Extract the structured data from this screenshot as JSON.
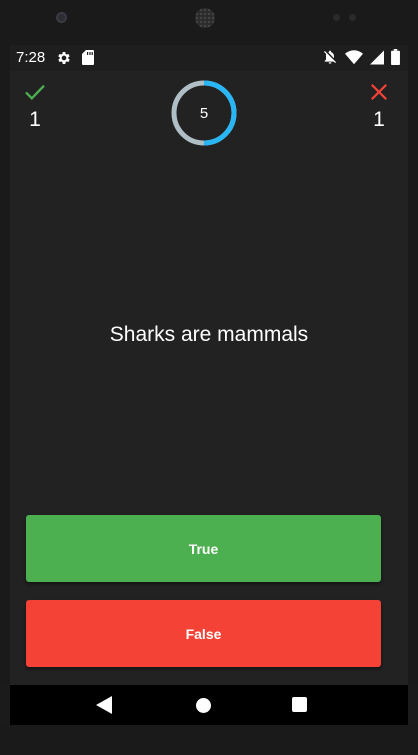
{
  "status_bar": {
    "time": "7:28",
    "icons": [
      "settings-icon",
      "sd-card-icon",
      "alarm-off-icon",
      "wifi-icon",
      "signal-icon",
      "battery-icon"
    ]
  },
  "score": {
    "correct_count": "1",
    "wrong_count": "1",
    "correct_icon": "check-icon",
    "wrong_icon": "close-icon",
    "correct_color": "#4caf50",
    "wrong_color": "#f44336"
  },
  "timer": {
    "value": "5",
    "progress": 0.5,
    "track_color": "#b0bec5",
    "progress_color": "#29b6f6"
  },
  "question": {
    "text": "Sharks are mammals"
  },
  "answers": {
    "true_label": "True",
    "false_label": "False",
    "true_color": "#4caf50",
    "false_color": "#f44336"
  },
  "nav": {
    "icons": [
      "back-icon",
      "home-icon",
      "recents-icon"
    ]
  }
}
